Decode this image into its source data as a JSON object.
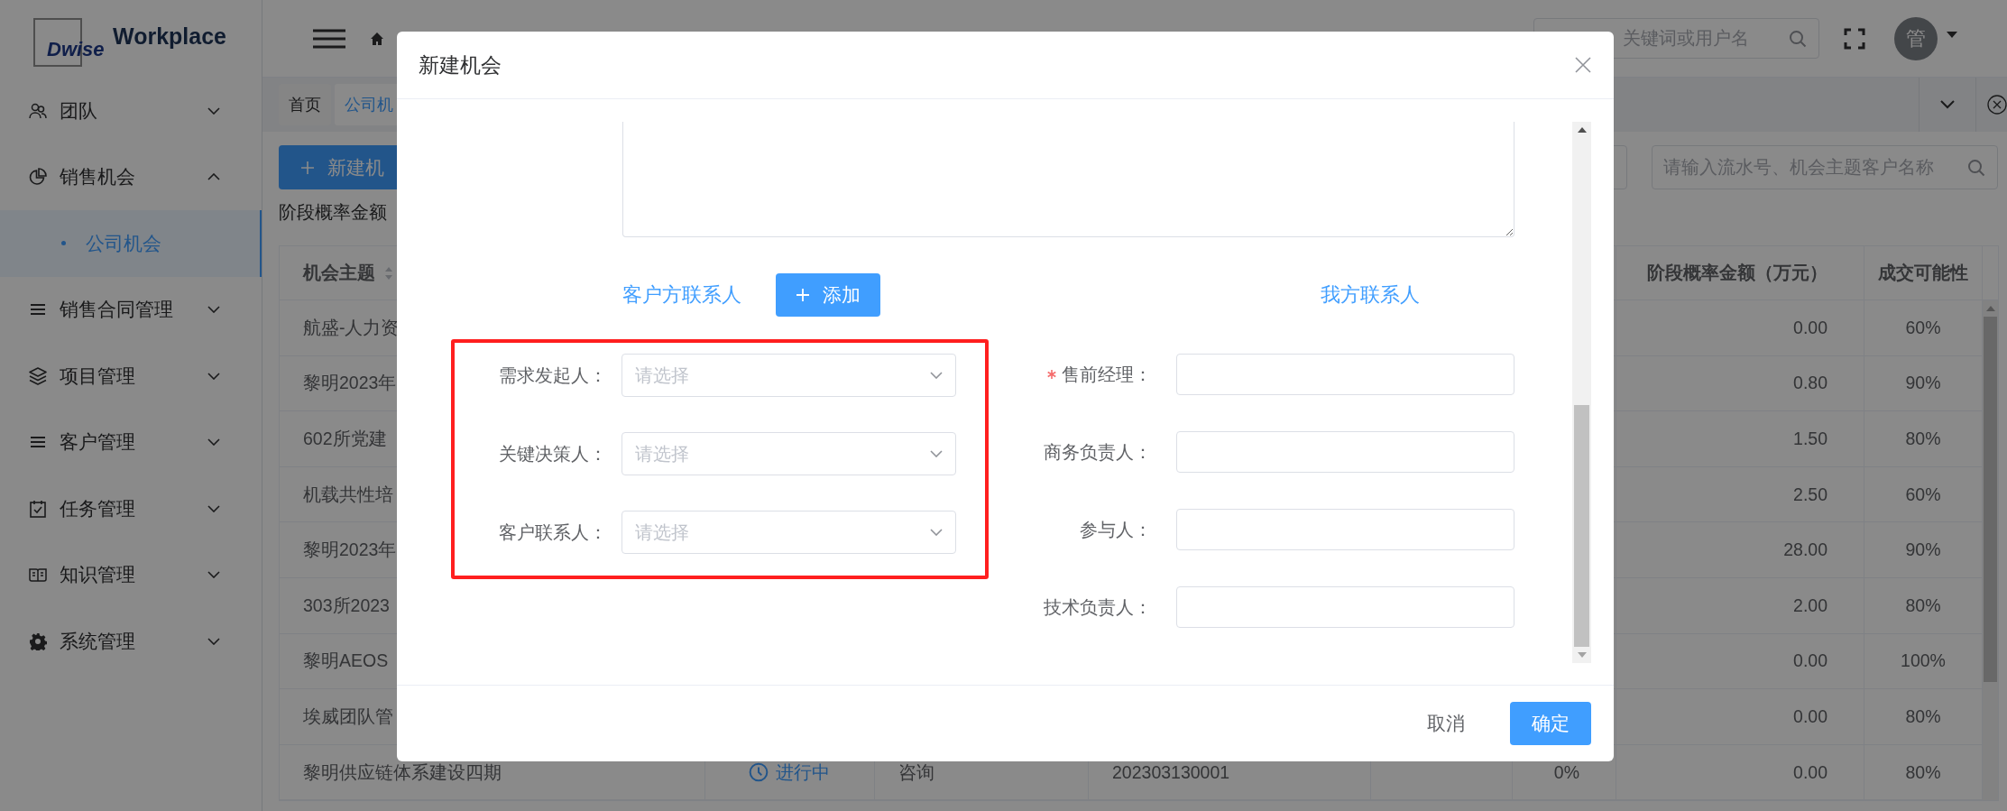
{
  "sidebar": {
    "logo": {
      "mark": "Dwise",
      "name": "Workplace"
    },
    "items": [
      {
        "label": "团队",
        "expanded": false
      },
      {
        "label": "销售机会",
        "expanded": true,
        "children": [
          {
            "label": "公司机会",
            "selected": true
          }
        ]
      },
      {
        "label": "销售合同管理",
        "expanded": false
      },
      {
        "label": "项目管理",
        "expanded": false
      },
      {
        "label": "客户管理",
        "expanded": false
      },
      {
        "label": "任务管理",
        "expanded": false
      },
      {
        "label": "知识管理",
        "expanded": false
      },
      {
        "label": "系统管理",
        "expanded": false
      }
    ]
  },
  "header": {
    "search": {
      "placeholder": "关键词或用户名"
    },
    "avatar": "管"
  },
  "tabs": [
    {
      "label": "首页",
      "selected": false
    },
    {
      "label": "公司机",
      "selected": true
    }
  ],
  "toolbar": {
    "new_button": "新建机",
    "search": {
      "placeholder": "请输入流水号、机会主题客户名称"
    }
  },
  "summary": "阶段概率金额",
  "table": {
    "columns": [
      {
        "label": "机会主题"
      },
      {
        "label": "阶段概率金额（万元）"
      },
      {
        "label": "成交可能性"
      }
    ],
    "rows": [
      {
        "subject": "航盛-人力资",
        "amount": "0.00",
        "possibility": "60%"
      },
      {
        "subject": "黎明2023年",
        "amount": "0.80",
        "possibility": "90%"
      },
      {
        "subject": "602所党建",
        "amount": "1.50",
        "possibility": "80%"
      },
      {
        "subject": "机载共性培",
        "amount": "2.50",
        "possibility": "60%"
      },
      {
        "subject": "黎明2023年",
        "amount": "28.00",
        "possibility": "90%"
      },
      {
        "subject": "303所2023",
        "amount": "2.00",
        "possibility": "80%"
      },
      {
        "subject": "黎明AEOS",
        "amount": "0.00",
        "possibility": "100%"
      },
      {
        "subject": "埃威团队管",
        "amount": "0.00",
        "possibility": "80%"
      },
      {
        "subject": "黎明供应链体系建设四期",
        "status": "进行中",
        "column_3": "咨询",
        "column_4": "202303130001",
        "column_6": "0%",
        "amount": "0.00",
        "possibility": "80%"
      }
    ]
  },
  "dialog": {
    "title": "新建机会",
    "customer_contacts": {
      "title": "客户方联系人",
      "add_button": "添加",
      "highlighted": true,
      "fields": [
        {
          "label": "需求发起人：",
          "placeholder": "请选择"
        },
        {
          "label": "关键决策人：",
          "placeholder": "请选择"
        },
        {
          "label": "客户联系人：",
          "placeholder": "请选择"
        }
      ]
    },
    "our_contacts": {
      "title": "我方联系人",
      "fields": [
        {
          "label": "售前经理：",
          "required": true
        },
        {
          "label": "商务负责人：",
          "required": false
        },
        {
          "label": "参与人：",
          "required": false
        },
        {
          "label": "技术负责人：",
          "required": false
        }
      ]
    },
    "cancel_button": "取消",
    "ok_button": "确定"
  }
}
